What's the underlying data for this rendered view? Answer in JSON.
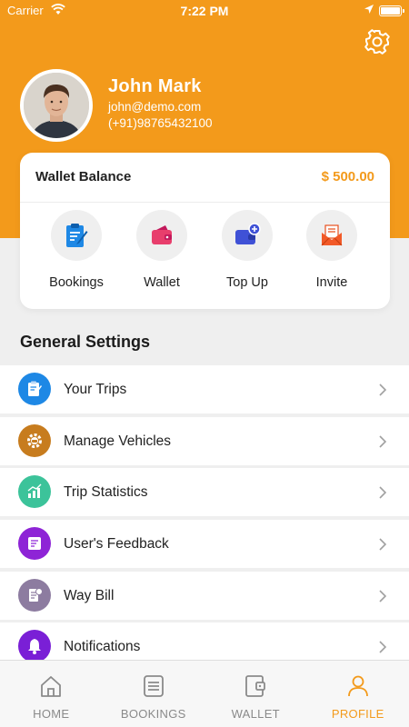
{
  "status_bar": {
    "carrier": "Carrier",
    "time": "7:22 PM"
  },
  "profile": {
    "name": "John Mark",
    "email": "john@demo.com",
    "phone": "(+91)98765432100"
  },
  "wallet": {
    "title": "Wallet Balance",
    "amount": "$ 500.00",
    "actions": [
      {
        "label": "Bookings",
        "icon": "clipboard-icon"
      },
      {
        "label": "Wallet",
        "icon": "wallet-icon"
      },
      {
        "label": "Top Up",
        "icon": "top-up-wallet-icon"
      },
      {
        "label": "Invite",
        "icon": "envelope-icon"
      }
    ]
  },
  "settings": {
    "title": "General Settings",
    "items": [
      {
        "label": "Your Trips",
        "icon": "clipboard-icon",
        "color": "#1e88e5"
      },
      {
        "label": "Manage Vehicles",
        "icon": "gear-car-icon",
        "color": "#c77c1e"
      },
      {
        "label": "Trip Statistics",
        "icon": "chart-icon",
        "color": "#3cc39a"
      },
      {
        "label": "User's Feedback",
        "icon": "feedback-icon",
        "color": "#8e24d6"
      },
      {
        "label": "Way Bill",
        "icon": "bill-icon",
        "color": "#8d7ca0"
      },
      {
        "label": "Notifications",
        "icon": "bell-icon",
        "color": "#7a1fd6"
      }
    ]
  },
  "tabbar": {
    "tabs": [
      {
        "label": "HOME",
        "icon": "home-icon"
      },
      {
        "label": "BOOKINGS",
        "icon": "list-icon"
      },
      {
        "label": "WALLET",
        "icon": "wallet-icon"
      },
      {
        "label": "PROFILE",
        "icon": "user-icon",
        "active": true
      }
    ]
  },
  "colors": {
    "accent": "#f39a1b",
    "background": "#efefef"
  }
}
